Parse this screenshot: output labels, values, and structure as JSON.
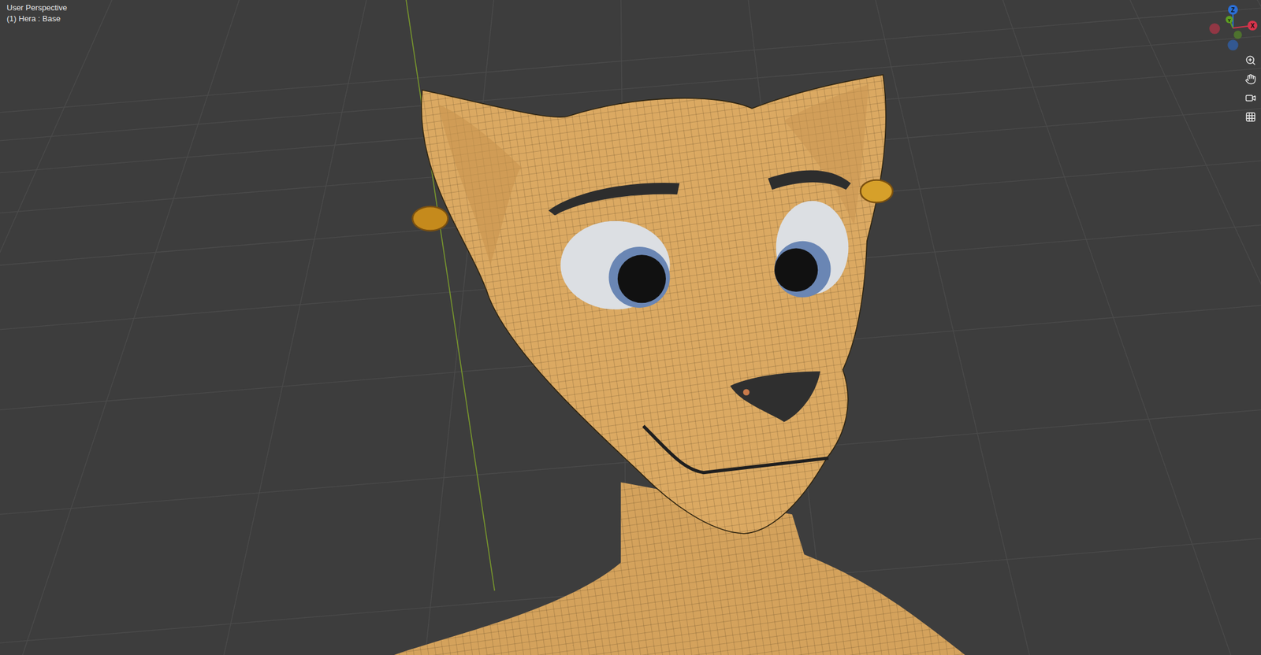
{
  "viewport": {
    "view": "User Perspective",
    "object": "(1) Hera : Base"
  },
  "gizmo": {
    "axes": [
      {
        "label": "Z",
        "color": "#2b6fd6"
      },
      {
        "label": "Y",
        "color": "#5d9e22"
      },
      {
        "label": "X",
        "color": "#d6334b"
      }
    ]
  }
}
